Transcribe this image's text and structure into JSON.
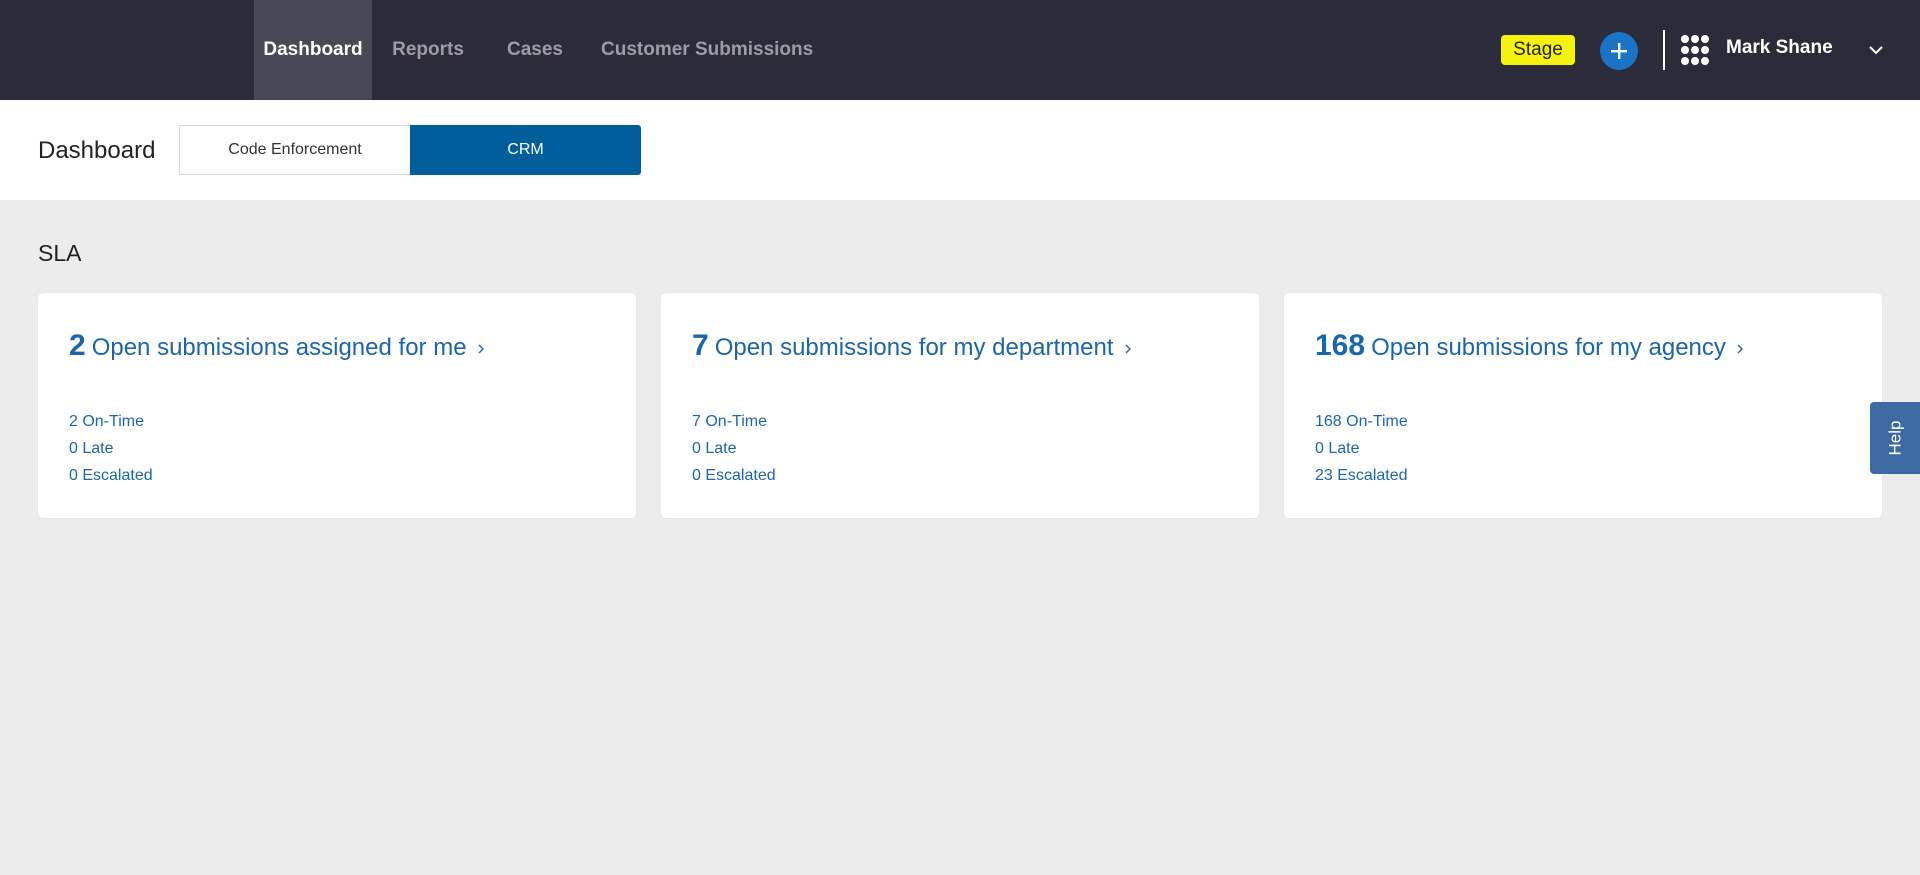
{
  "nav": {
    "items": [
      {
        "label": "Dashboard",
        "active": true
      },
      {
        "label": "Reports"
      },
      {
        "label": "Cases"
      },
      {
        "label": "Customer Submissions"
      }
    ]
  },
  "header": {
    "stage_label": "Stage",
    "user_name": "Mark Shane",
    "colors": {
      "bar": "#2c2b3a",
      "stage": "#f6f20c",
      "add_button": "#1a73c4"
    }
  },
  "subheader": {
    "title": "Dashboard",
    "toggle": [
      {
        "label": "Code Enforcement",
        "selected": false
      },
      {
        "label": "CRM",
        "selected": true
      }
    ]
  },
  "sla": {
    "heading": "SLA",
    "cards": [
      {
        "count": "2",
        "label": "Open submissions assigned for me",
        "on_time": "2 On-Time",
        "late": "0 Late",
        "escalated": "0 Escalated"
      },
      {
        "count": "7",
        "label": "Open submissions for my department",
        "on_time": "7 On-Time",
        "late": "0 Late",
        "escalated": "0 Escalated"
      },
      {
        "count": "168",
        "label": "Open submissions for my agency",
        "on_time": "168 On-Time",
        "late": "0 Late",
        "escalated": "23 Escalated"
      }
    ]
  },
  "help": {
    "label": "Help"
  }
}
